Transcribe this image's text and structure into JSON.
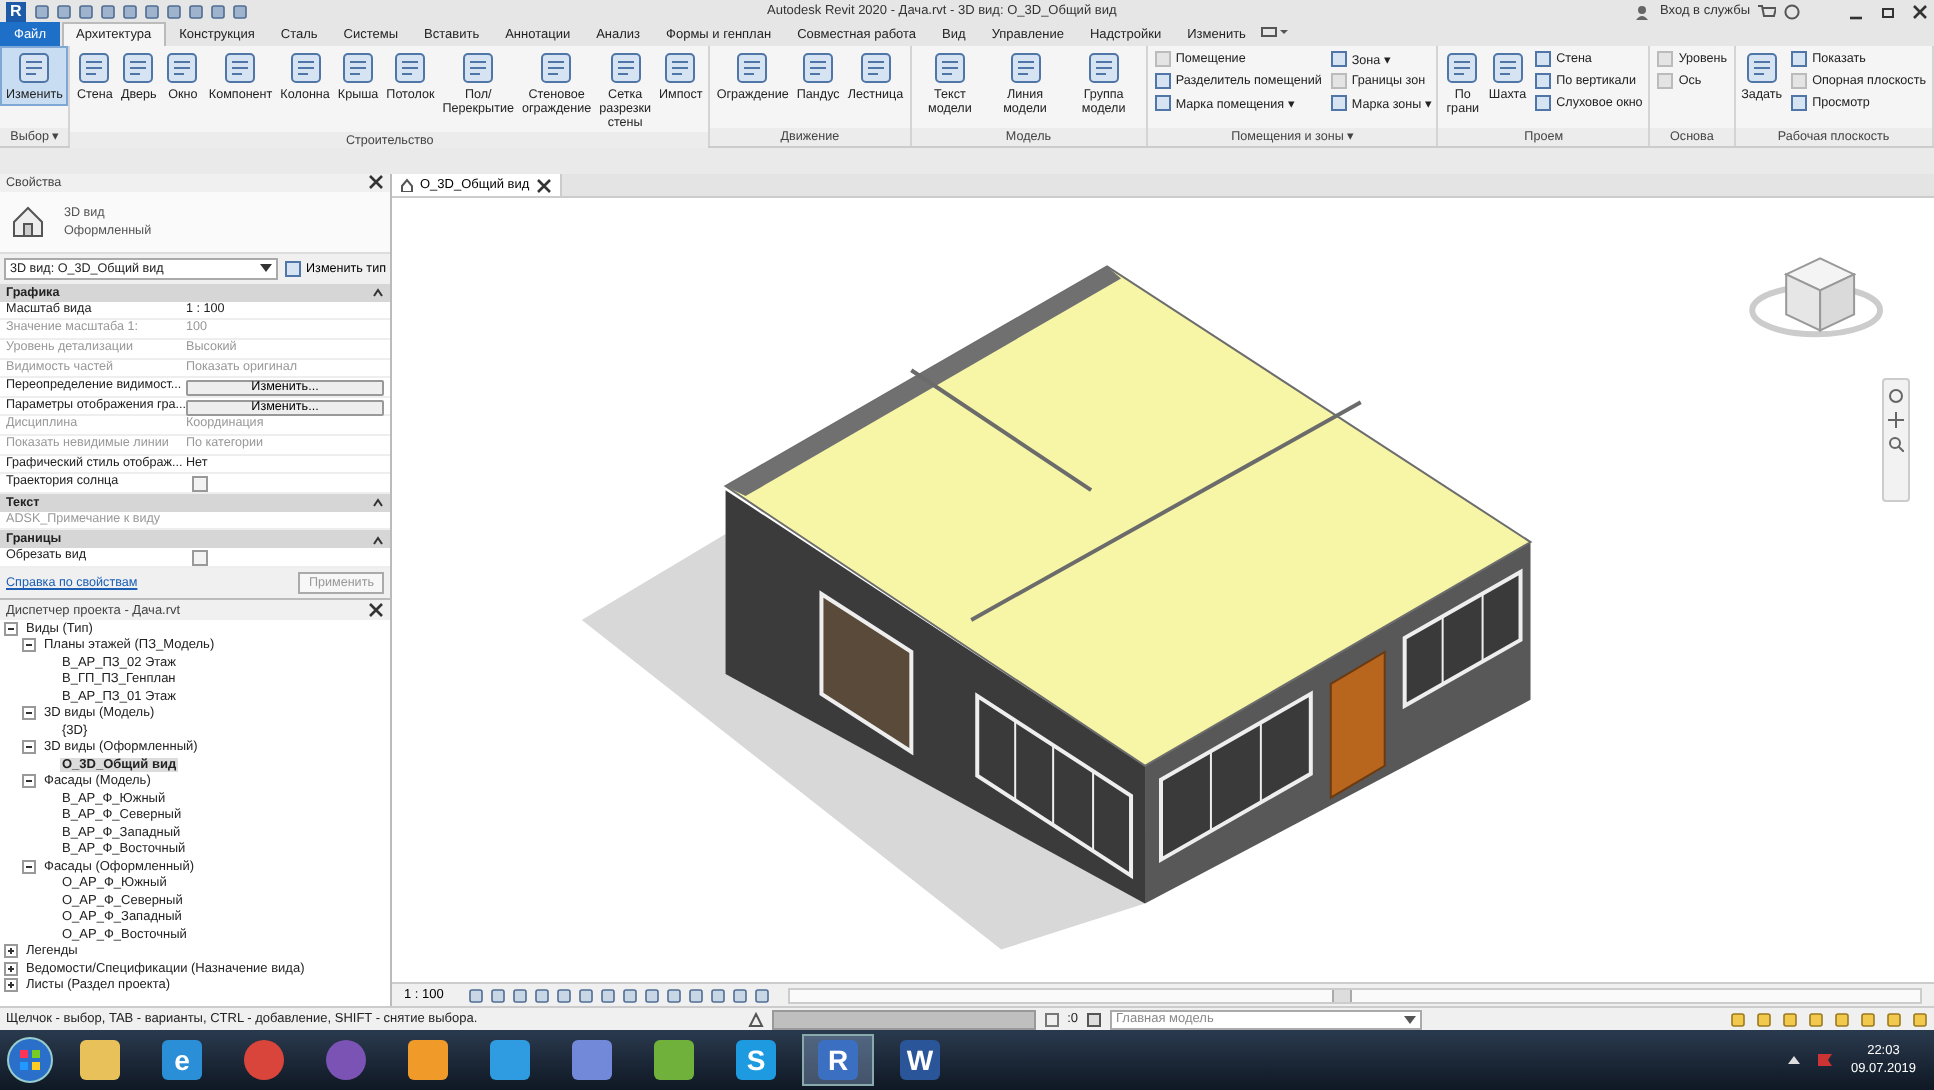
{
  "window": {
    "app_logo": "R",
    "title": "Autodesk Revit 2020 - Дача.rvt - 3D вид: О_3D_Общий вид",
    "sign_in": "Вход в службы"
  },
  "menu_tabs": [
    {
      "label": "Файл",
      "kind": "file",
      "selected": false
    },
    {
      "label": "Архитектура",
      "kind": "tab",
      "selected": true
    },
    {
      "label": "Конструкция",
      "kind": "tab",
      "selected": false
    },
    {
      "label": "Сталь",
      "kind": "tab",
      "selected": false
    },
    {
      "label": "Системы",
      "kind": "tab",
      "selected": false
    },
    {
      "label": "Вставить",
      "kind": "tab",
      "selected": false
    },
    {
      "label": "Аннотации",
      "kind": "tab",
      "selected": false
    },
    {
      "label": "Анализ",
      "kind": "tab",
      "selected": false
    },
    {
      "label": "Формы и генплан",
      "kind": "tab",
      "selected": false
    },
    {
      "label": "Совместная работа",
      "kind": "tab",
      "selected": false
    },
    {
      "label": "Вид",
      "kind": "tab",
      "selected": false
    },
    {
      "label": "Управление",
      "kind": "tab",
      "selected": false
    },
    {
      "label": "Надстройки",
      "kind": "tab",
      "selected": false
    },
    {
      "label": "Изменить",
      "kind": "tab",
      "selected": false
    }
  ],
  "ribbon": [
    {
      "label": "Выбор ▾",
      "tools": [
        {
          "label": "Изменить",
          "kind": "large",
          "active": true,
          "disabled": false
        }
      ]
    },
    {
      "label": "Строительство",
      "tools": [
        {
          "label": "Стена",
          "kind": "large",
          "active": false,
          "disabled": false
        },
        {
          "label": "Дверь",
          "kind": "large",
          "active": false,
          "disabled": false
        },
        {
          "label": "Окно",
          "kind": "large",
          "active": false,
          "disabled": false
        },
        {
          "label": "Компонент",
          "kind": "large",
          "active": false,
          "disabled": false
        },
        {
          "label": "Колонна",
          "kind": "large",
          "active": false,
          "disabled": false
        },
        {
          "label": "Крыша",
          "kind": "large",
          "active": false,
          "disabled": false
        },
        {
          "label": "Потолок",
          "kind": "large",
          "active": false,
          "disabled": false
        },
        {
          "label": "Пол/Перекрытие",
          "kind": "large",
          "active": false,
          "disabled": false
        },
        {
          "label": "Стеновое ограждение",
          "kind": "large",
          "active": false,
          "disabled": false
        },
        {
          "label": "Сетка разрезки стены",
          "kind": "large",
          "active": false,
          "disabled": false
        },
        {
          "label": "Импост",
          "kind": "large",
          "active": false,
          "disabled": false
        }
      ]
    },
    {
      "label": "Движение",
      "tools": [
        {
          "label": "Ограждение",
          "kind": "large",
          "active": false,
          "disabled": false
        },
        {
          "label": "Пандус",
          "kind": "large",
          "active": false,
          "disabled": false
        },
        {
          "label": "Лестница",
          "kind": "large",
          "active": false,
          "disabled": false
        }
      ]
    },
    {
      "label": "Модель",
      "tools": [
        {
          "label": "Текст модели",
          "kind": "large",
          "active": false,
          "disabled": false
        },
        {
          "label": "Линия модели",
          "kind": "large",
          "active": false,
          "disabled": false
        },
        {
          "label": "Группа модели",
          "kind": "large",
          "active": false,
          "disabled": false
        }
      ]
    },
    {
      "label": "Помещения и зоны ▾",
      "tools": [
        {
          "label": "Помещение",
          "kind": "small",
          "active": false,
          "disabled": true
        },
        {
          "label": "Разделитель помещений",
          "kind": "small",
          "active": false,
          "disabled": false
        },
        {
          "label": "Марка помещения ▾",
          "kind": "small",
          "active": false,
          "disabled": false
        },
        {
          "label": "Зона ▾",
          "kind": "small",
          "active": false,
          "disabled": false
        },
        {
          "label": "Границы зон",
          "kind": "small",
          "active": false,
          "disabled": true
        },
        {
          "label": "Марка зоны ▾",
          "kind": "small",
          "active": false,
          "disabled": false
        }
      ]
    },
    {
      "label": "Проем",
      "tools": [
        {
          "label": "По грани",
          "kind": "large",
          "active": false,
          "disabled": false
        },
        {
          "label": "Шахта",
          "kind": "large",
          "active": false,
          "disabled": false
        },
        {
          "label": "Стена",
          "kind": "small",
          "active": false,
          "disabled": false
        },
        {
          "label": "По вертикали",
          "kind": "small",
          "active": false,
          "disabled": false
        },
        {
          "label": "Слуховое окно",
          "kind": "small",
          "active": false,
          "disabled": false
        }
      ]
    },
    {
      "label": "Основа",
      "tools": [
        {
          "label": "Уровень",
          "kind": "small",
          "active": false,
          "disabled": true
        },
        {
          "label": "Ось",
          "kind": "small",
          "active": false,
          "disabled": true
        }
      ]
    },
    {
      "label": "Рабочая плоскость",
      "tools": [
        {
          "label": "Задать",
          "kind": "large",
          "active": false,
          "disabled": false
        },
        {
          "label": "Показать",
          "kind": "small",
          "active": false,
          "disabled": false
        },
        {
          "label": "Опорная плоскость",
          "kind": "small",
          "active": false,
          "disabled": true
        },
        {
          "label": "Просмотр",
          "kind": "small",
          "active": false,
          "disabled": false
        }
      ]
    }
  ],
  "properties": {
    "title": "Свойства",
    "type_name": "3D вид",
    "type_sub": "Оформленный",
    "instance_selector": "3D вид: О_3D_Общий вид",
    "edit_type": "Изменить тип",
    "groups": [
      {
        "name": "Графика",
        "rows": [
          {
            "label": "Масштаб вида",
            "kind": "text",
            "value": "1 : 100",
            "disabled": false
          },
          {
            "label": "Значение масштаба    1:",
            "kind": "text",
            "value": "100",
            "disabled": true
          },
          {
            "label": "Уровень детализации",
            "kind": "text",
            "value": "Высокий",
            "disabled": true
          },
          {
            "label": "Видимость частей",
            "kind": "text",
            "value": "Показать оригинал",
            "disabled": true
          },
          {
            "label": "Переопределение видимост...",
            "kind": "button",
            "value": "Изменить...",
            "disabled": false
          },
          {
            "label": "Параметры отображения гра...",
            "kind": "button",
            "value": "Изменить...",
            "disabled": false
          },
          {
            "label": "Дисциплина",
            "kind": "text",
            "value": "Координация",
            "disabled": true
          },
          {
            "label": "Показать невидимые линии",
            "kind": "text",
            "value": "По категории",
            "disabled": true
          },
          {
            "label": "Графический стиль отображ...",
            "kind": "text",
            "value": "Нет",
            "disabled": false
          },
          {
            "label": "Траектория солнца",
            "kind": "checkbox",
            "checked": false,
            "disabled": false
          }
        ]
      },
      {
        "name": "Текст",
        "rows": [
          {
            "label": "ADSK_Примечание к виду",
            "kind": "text",
            "disabled": true
          }
        ]
      },
      {
        "name": "Границы",
        "rows": [
          {
            "label": "Обрезать вид",
            "kind": "checkbox",
            "checked": false,
            "disabled": false
          }
        ]
      }
    ],
    "help_link": "Справка по свойствам",
    "apply": "Применить",
    "apply_disabled": true
  },
  "project_browser": {
    "title": "Диспетчер проекта - Дача.rvt",
    "tree": [
      {
        "label": "Виды (Тип)",
        "expanded": true,
        "selected": false,
        "children": [
          {
            "label": "Планы этажей (ПЗ_Модель)",
            "expanded": true,
            "selected": false,
            "children": [
              {
                "label": "В_АР_ПЗ_02 Этаж",
                "selected": false
              },
              {
                "label": "В_ГП_ПЗ_Генплан",
                "selected": false
              },
              {
                "label": "В_АР_ПЗ_01 Этаж",
                "selected": false
              }
            ]
          },
          {
            "label": "3D виды (Модель)",
            "expanded": true,
            "selected": false,
            "children": [
              {
                "label": "{3D}",
                "selected": false
              }
            ]
          },
          {
            "label": "3D виды (Оформленный)",
            "expanded": true,
            "selected": false,
            "children": [
              {
                "label": "О_3D_Общий вид",
                "selected": true
              }
            ]
          },
          {
            "label": "Фасады (Модель)",
            "expanded": true,
            "selected": false,
            "children": [
              {
                "label": "В_АР_Ф_Южный",
                "selected": false
              },
              {
                "label": "В_АР_Ф_Северный",
                "selected": false
              },
              {
                "label": "В_АР_Ф_Западный",
                "selected": false
              },
              {
                "label": "В_АР_Ф_Восточный",
                "selected": false
              }
            ]
          },
          {
            "label": "Фасады (Оформленный)",
            "expanded": true,
            "selected": false,
            "children": [
              {
                "label": "О_АР_Ф_Южный",
                "selected": false
              },
              {
                "label": "О_АР_Ф_Северный",
                "selected": false
              },
              {
                "label": "О_АР_Ф_Западный",
                "selected": false
              },
              {
                "label": "О_АР_Ф_Восточный",
                "selected": false
              }
            ]
          }
        ]
      },
      {
        "label": "Легенды",
        "expanded": false,
        "selected": false
      },
      {
        "label": "Ведомости/Спецификации (Назначение вида)",
        "expanded": false,
        "selected": false
      },
      {
        "label": "Листы (Раздел проекта)",
        "expanded": false,
        "selected": false
      }
    ]
  },
  "view": {
    "tab": "О_3D_Общий вид",
    "scale": "1 : 100"
  },
  "status_bar": {
    "hint": "Щелчок - выбор, TAB - варианты, CTRL - добавление, SHIFT - снятие выбора.",
    "count": ":0",
    "model": "Главная модель"
  },
  "taskbar": {
    "apps": [
      {
        "kind": "folder",
        "active": false
      },
      {
        "kind": "ie",
        "glyph": "e",
        "active": false
      },
      {
        "kind": "chrome",
        "active": false
      },
      {
        "kind": "viber",
        "active": false
      },
      {
        "kind": "player",
        "active": false
      },
      {
        "kind": "store",
        "active": false
      },
      {
        "kind": "discord",
        "active": false
      },
      {
        "kind": "torrent",
        "active": false
      },
      {
        "kind": "skype",
        "glyph": "S",
        "active": false
      },
      {
        "kind": "revit",
        "glyph": "R",
        "active": true
      },
      {
        "kind": "word",
        "glyph": "W",
        "active": false
      }
    ],
    "time": "22:03",
    "date": "09.07.2019"
  }
}
